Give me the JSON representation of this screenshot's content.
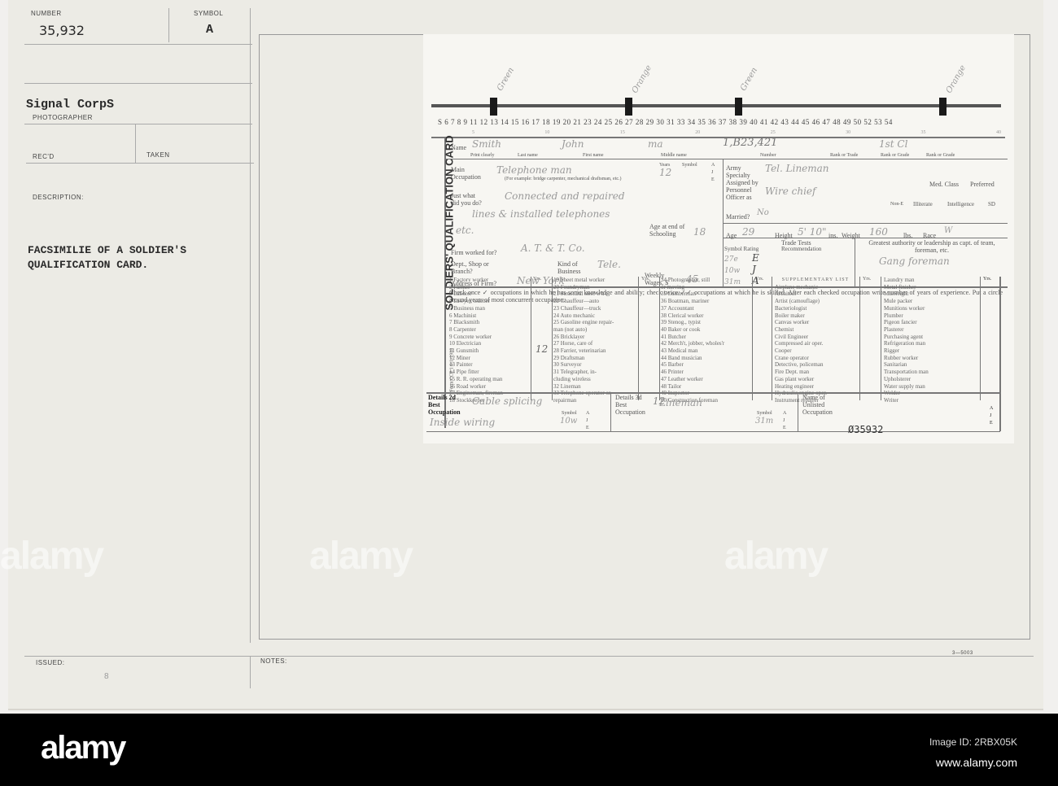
{
  "index_card": {
    "number_label": "NUMBER",
    "number": "35,932",
    "symbol_label": "SYMBOL",
    "symbol": "A",
    "photographer": "Signal CorpS",
    "photographer_label": "PHOTOGRAPHER",
    "recd_label": "REC'D",
    "taken_label": "TAKEN",
    "description_label": "DESCRIPTION:",
    "description_line1": "FACSIMILIE OF A SOLDIER'S",
    "description_line2": "QUALIFICATION CARD.",
    "issued_label": "ISSUED:",
    "issued_mark": "8",
    "notes_label": "NOTES:",
    "form_code": "3—5003"
  },
  "qualification_card": {
    "vertical_title": "SOLDIERS' QUALIFICATION CARD",
    "form_label": "Form CCP 1 6-1-1918",
    "handwritten_marks": [
      "Green",
      "Orange",
      "Green",
      "Orange"
    ],
    "scale_numbers": "S 6 7 8 9  11 12 13 14 15 16 17 18 19 20 21  23 24 25 26 27 28 29 30 31  33 34 35 36 37 38 39 40 41 42 43 44 45 46 47 48 49 50  52 53 54",
    "scale_sub": [
      "5",
      "10",
      "15",
      "20",
      "25",
      "30",
      "35",
      "40"
    ],
    "name_label": "Name",
    "print_clearly": "Print clearly",
    "last_name": "Last name",
    "first_name": "First name",
    "middle_name": "Middle name",
    "name_last": "Smith",
    "name_first": "John",
    "name_middle": "ma",
    "number_value": "1,B23,421",
    "number_caption": "Number",
    "rank_captions": [
      "Rank or Trade",
      "Rank or Grade",
      "Rank or Grade"
    ],
    "rank_value": "1st Cl",
    "main_occupation_label": "Main Occupation",
    "main_occupation_value": "Telephone man",
    "main_occupation_hint": "(For example: bridge carpenter, mechanical draftsman, etc.)",
    "years_label": "Years",
    "years_value": "12",
    "symbol_label": "Symbol",
    "symbol_ajs": "A J E",
    "just_what_label": "Just what did you do?",
    "just_what_value": [
      "Connected and repaired",
      "lines & installed telephones",
      "etc."
    ],
    "age_schooling_label": "Age at end of Schooling",
    "age_schooling_value": "18",
    "firm_label": "Firm worked for?",
    "firm_value": "A. T. & T. Co.",
    "dept_label": "Dept., Shop or Branch?",
    "kind_label": "Kind of Business",
    "kind_value": "Tele.",
    "address_label": "Address of Firm?",
    "address_value": "New York",
    "wages_label": "Weekly Wages, $",
    "wages_value": "45",
    "army_specialty_label": "Army Specialty Assigned by Personnel Officer as",
    "army_specialty_value": "Tel. Lineman",
    "officer_value": "Wire chief",
    "med_class_label": "Med. Class",
    "preferred_label": "Preferred",
    "non_e_label": "Non-E",
    "illiterate_label": "Illiterate",
    "intelligence_label": "Intelligence",
    "sd_label": "SD",
    "married_label": "Married?",
    "married_value": "No",
    "age_label": "Age",
    "age_value": "29",
    "height_label": "Height",
    "height_value": "5' 10\"",
    "ins_label": "ins.",
    "weight_label": "Weight",
    "weight_value": "160",
    "lbs_label": "lbs.",
    "race_label": "Race",
    "race_value": "W",
    "trade_tests_label": "Trade Tests",
    "symbol_rating_label": "Symbol Rating",
    "recommendation_label": "Recommendation",
    "trade_tests": [
      {
        "symbol": "27e",
        "rating": "E"
      },
      {
        "symbol": "10w",
        "rating": "J"
      },
      {
        "symbol": "31m",
        "rating": "A"
      }
    ],
    "leadership_label": "Greatest authority or leadership as capt. of team, foreman, etc.",
    "leadership_value": "Gang foreman",
    "instructions": "Check once ✓ occupations in which he has some knowledge and ability; check twice ✓✓ occupations at which he is skilled. After each checked occupation write number of years of experience. Put a circle around years of most concurrent occupation.",
    "yrs_label": "Yrs.",
    "columns": [
      [
        "1 Factory worker",
        "2 Farmer",
        "3 Laborer",
        "4 Lawyer, teacher",
        "5 Business man",
        "6 Machinist",
        "7 Blacksmith",
        "8 Carpenter",
        "9 Concrete worker",
        "10 Electrician",
        "11 Gunsmith",
        "12 Miner",
        "13 Painter",
        "14 Pipe fitter",
        "15 R. R. operating man",
        "16 Road worker",
        "17 Engineman, fireman",
        "18 Stockkeeper"
      ],
      [
        "19 Sheet metal worker",
        "20 Foundryman",
        "21 Structural steel w'k'r",
        "22 Chauffeur—auto",
        "23 Chauffeur—truck",
        "24 Auto mechanic",
        "25 Gasoline engine repair-",
        "   man (not auto)",
        "26 Bricklayer",
        "27 Horse, care of",
        "28 Farrier, veterinarian",
        "29 Draftsman",
        "30 Surveyor",
        "31 Telegrapher, in-",
        "   cluding wireless",
        "32 Lineman",
        "33 Telephone operator or",
        "   repairman"
      ],
      [
        "34 Photographer, still",
        "   or moving",
        "35 Lumberman",
        "36 Boatman, mariner",
        "37 Accountant",
        "38 Clerical worker",
        "39 Stenog., typist",
        "40 Baker or cook",
        "41 Butcher",
        "42 Merch't, jobber, wholes'r",
        "43 Medical man",
        "44 Band musician",
        "45 Barber",
        "46 Printer",
        "47 Leather worker",
        "48 Tailor",
        "49 Inspector",
        "50 Construction foreman"
      ],
      [
        "SUPPLEMENTARY LIST",
        "Airplane mechanic",
        "Architect",
        "Artist (camouflage)",
        "Bacteriologist",
        "Boiler maker",
        "Canvas worker",
        "Chemist",
        "Civil Engineer",
        "Compressed air oper.",
        "Cooper",
        "Crane operator",
        "Detective, policeman",
        "Fire Dept. man",
        "Gas plant worker",
        "Heating engineer",
        "Hydraulic engine oper.",
        "Instrument repairer"
      ],
      [
        "Laundry man",
        "Metal finisher",
        "Millwright",
        "Mule packer",
        "Munitions worker",
        "Plumber",
        "Pigeon fancier",
        "Plasterer",
        "Purchasing agent",
        "Refrigeration man",
        "Rigger",
        "Rubber worker",
        "Sanitarian",
        "Transportation man",
        "Upholsterer",
        "Water supply man",
        "Welder",
        "Writer"
      ]
    ],
    "col_years": [
      "12",
      "",
      "12"
    ],
    "details_2d_label": "Details 2d Best Occupation",
    "details_2d_value": "Cable splicing",
    "details_2d_value2": "Inside wiring",
    "details_2d_symbol": "10w",
    "details_3d_label": "Details 3d Best Occupation",
    "details_3d_value": "Lineman",
    "details_3d_symbol": "31m",
    "symbol_small": "Symbol",
    "ajx": "A J E",
    "unlisted_label": "Name of Unlisted Occupation",
    "serial_stamp": "Ø35932"
  },
  "watermark": {
    "brand": "alamy",
    "image_id": "Image ID: 2RBX05K",
    "url": "www.alamy.com"
  }
}
